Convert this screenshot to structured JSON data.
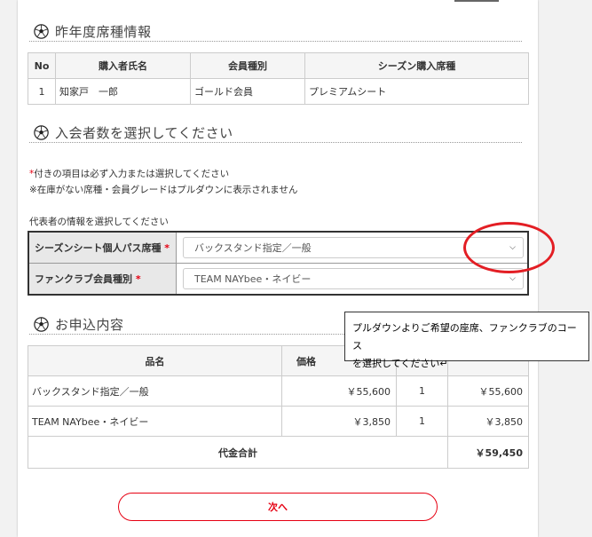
{
  "sections": {
    "previous": {
      "title": "昨年度席種情報"
    },
    "members": {
      "title": "入会者数を選択してください"
    },
    "order": {
      "title": "お申込内容"
    }
  },
  "prev_table": {
    "headers": [
      "No",
      "購入者氏名",
      "会員種別",
      "シーズン購入席種"
    ],
    "rows": [
      [
        "1",
        "知家戸　一郎",
        "ゴールド会員",
        "プレミアムシート"
      ]
    ]
  },
  "notes": {
    "required_mark": "*",
    "required_text": "付きの項目は必ず入力または選択してください",
    "stock_note": "※在庫がない席種・会員グレードはプルダウンに表示されません",
    "rep_label": "代表者の情報を選択してください"
  },
  "form": {
    "seat_label": "シーズンシート個人パス席種",
    "seat_value": "バックスタンド指定／一般",
    "club_label": "ファンクラブ会員種別",
    "club_value": "TEAM NAYbee・ネイビー",
    "required_mark": "*"
  },
  "order_table": {
    "headers": [
      "品名",
      "価格"
    ],
    "rows": [
      {
        "name": "バックスタンド指定／一般",
        "price": "￥55,600",
        "qty": "1",
        "subtotal": "￥55,600"
      },
      {
        "name": "TEAM NAYbee・ネイビー",
        "price": "￥3,850",
        "qty": "1",
        "subtotal": "￥3,850"
      }
    ],
    "total_label": "代金合計",
    "total_value": "￥59,450"
  },
  "callout": {
    "line1": "プルダウンよりご希望の座席、ファンクラブのコース",
    "line2": "を選択してください↵"
  },
  "buttons": {
    "next": "次へ"
  },
  "colors": {
    "accent": "#e60012",
    "annotation": "#e31e24"
  }
}
